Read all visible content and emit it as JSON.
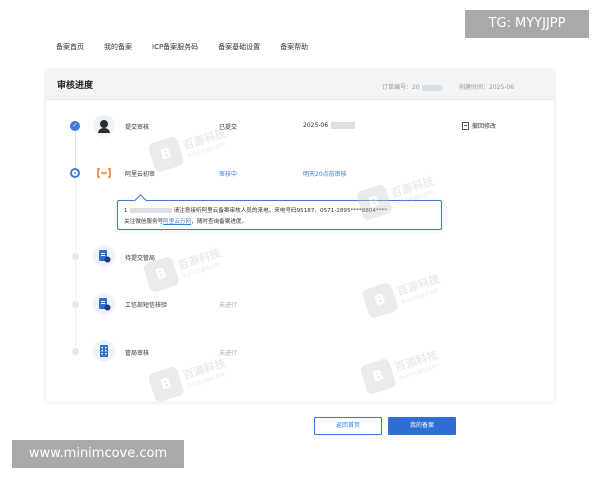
{
  "nav": {
    "items": [
      "备案首页",
      "我的备案",
      "ICP备案服务码",
      "备案基础设置",
      "备案帮助"
    ]
  },
  "panel": {
    "title": "审核进度",
    "order_label": "订单编号：20",
    "created_label": "创建时间：2025-06"
  },
  "steps": [
    {
      "name": "提交审核",
      "status": "已提交",
      "extra": "2025-06",
      "icon": "avatar-icon",
      "state": "done"
    },
    {
      "name": "阿里云初审",
      "status": "审核中",
      "extra": "明天20点前审核",
      "icon": "aliyun-icon",
      "state": "current"
    },
    {
      "name": "待提交管局",
      "status": "",
      "extra": "",
      "icon": "document-submit-icon",
      "state": "pending"
    },
    {
      "name": "工信部短信核验",
      "status": "未进行",
      "extra": "",
      "icon": "sms-verify-icon",
      "state": "pending"
    },
    {
      "name": "管局审核",
      "status": "未进行",
      "extra": "",
      "icon": "building-icon",
      "state": "pending"
    }
  ],
  "revoke_label": "撤回修改",
  "tip": {
    "line1_prefix": "1",
    "line1_text": "请注意接听阿里云备案审核人员的来电，来电号码95187、0571-2895****8804****",
    "line2_prefix": "关注微信服务号",
    "line2_link": "阿里云万网",
    "line2_suffix": "，随时查询备案进度。"
  },
  "buttons": {
    "home": "返回首页",
    "mine": "我的备案"
  },
  "watermark": {
    "name": "百源科技",
    "tagline": "专业企业服务品牌"
  },
  "overlays": {
    "top_right": "TG: MYYJJPP",
    "bottom_left": "www.minimcove.com"
  },
  "colors": {
    "accent": "#3d7bd9",
    "primary_button": "#2f6fd3"
  }
}
